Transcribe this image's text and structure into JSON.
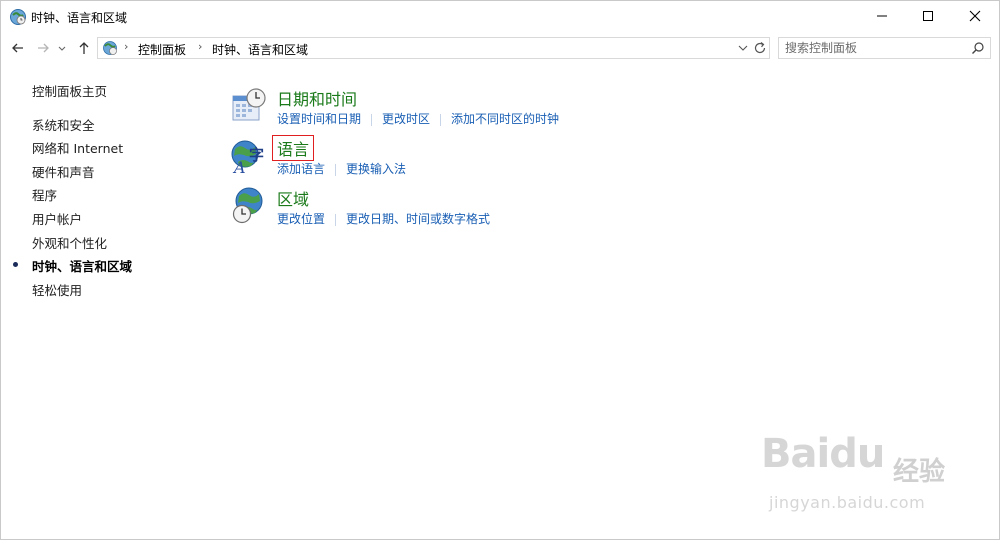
{
  "window": {
    "title": "时钟、语言和区域"
  },
  "nav": {
    "breadcrumbs": [
      "控制面板",
      "时钟、语言和区域"
    ],
    "search_placeholder": "搜索控制面板"
  },
  "sidebar": {
    "home": "控制面板主页",
    "items": [
      {
        "label": "系统和安全"
      },
      {
        "label": "网络和 Internet"
      },
      {
        "label": "硬件和声音"
      },
      {
        "label": "程序"
      },
      {
        "label": "用户帐户"
      },
      {
        "label": "外观和个性化"
      },
      {
        "label": "时钟、语言和区域",
        "current": true
      },
      {
        "label": "轻松使用"
      }
    ]
  },
  "categories": [
    {
      "title": "日期和时间",
      "icon": "calendar-clock-icon",
      "links": [
        "设置时间和日期",
        "更改时区",
        "添加不同时区的时钟"
      ]
    },
    {
      "title": "语言",
      "icon": "language-globe-icon",
      "links": [
        "添加语言",
        "更换输入法"
      ],
      "highlighted": true
    },
    {
      "title": "区域",
      "icon": "region-globe-clock-icon",
      "links": [
        "更改位置",
        "更改日期、时间或数字格式"
      ]
    }
  ],
  "watermark": {
    "logo": "Baidu",
    "cn": "经验",
    "url": "jingyan.baidu.com"
  },
  "colors": {
    "category_title": "#1a7a1a",
    "link": "#1a5fb4",
    "highlight_border": "#e02020"
  }
}
